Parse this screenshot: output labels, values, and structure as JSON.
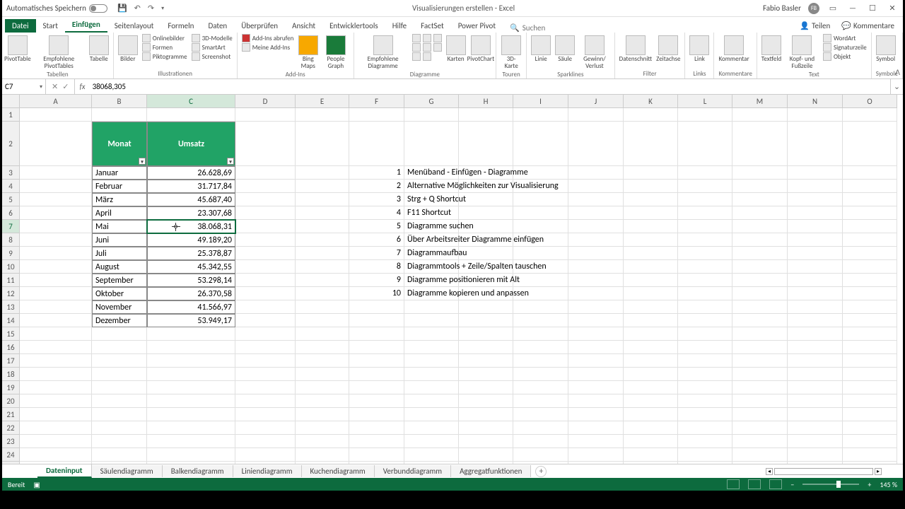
{
  "titlebar": {
    "autosave": "Automatisches Speichern",
    "doc_title": "Visualisierungen erstellen - Excel",
    "user": "Fabio Basler",
    "user_initials": "FB"
  },
  "tabs": {
    "file": "Datei",
    "items": [
      "Start",
      "Einfügen",
      "Seitenlayout",
      "Formeln",
      "Daten",
      "Überprüfen",
      "Ansicht",
      "Entwicklertools",
      "Hilfe",
      "FactSet",
      "Power Pivot"
    ],
    "active": "Einfügen",
    "search_placeholder": "Suchen",
    "share": "Teilen",
    "comments": "Kommentare"
  },
  "ribbon": {
    "groups": {
      "tabellen": {
        "label": "Tabellen",
        "pivottable": "PivotTable",
        "empfohlene": "Empfohlene\nPivotTables",
        "tabelle": "Tabelle"
      },
      "illustrationen": {
        "label": "Illustrationen",
        "bilder": "Bilder",
        "onlinebilder": "Onlinebilder",
        "formen": "Formen",
        "piktogramme": "Piktogramme",
        "modelle": "3D-Modelle",
        "smartart": "SmartArt",
        "screenshot": "Screenshot"
      },
      "addins": {
        "label": "Add-Ins",
        "abrufen": "Add-Ins abrufen",
        "meine": "Meine Add-Ins",
        "bing": "Bing\nMaps",
        "people": "People\nGraph"
      },
      "diagramme": {
        "label": "Diagramme",
        "empfohlene": "Empfohlene\nDiagramme",
        "karten": "Karten",
        "pivotchart": "PivotChart"
      },
      "touren": {
        "label": "Touren",
        "karte": "3D-\nKarte"
      },
      "sparklines": {
        "label": "Sparklines",
        "linie": "Linie",
        "saule": "Säule",
        "gewinn": "Gewinn/\nVerlust"
      },
      "filter": {
        "label": "Filter",
        "datenschnitt": "Datenschnitt",
        "zeitachse": "Zeitachse"
      },
      "links": {
        "label": "Links",
        "link": "Link"
      },
      "kommentare": {
        "label": "Kommentare",
        "kommentar": "Kommentar"
      },
      "text": {
        "label": "Text",
        "textfeld": "Textfeld",
        "kopf": "Kopf- und\nFußzeile",
        "wordart": "WordArt",
        "signatur": "Signaturzeile",
        "objekt": "Objekt"
      },
      "symbole": {
        "label": "Symbole",
        "symbol": "Symbol"
      }
    }
  },
  "formulabar": {
    "namebox": "C7",
    "formula": "38068,305"
  },
  "columns": [
    "A",
    "B",
    "C",
    "D",
    "E",
    "F",
    "G",
    "H",
    "I",
    "J",
    "K",
    "L",
    "M",
    "N",
    "O"
  ],
  "table": {
    "headers": {
      "monat": "Monat",
      "umsatz": "Umsatz"
    },
    "rows": [
      {
        "m": "Januar",
        "u": "26.628,69"
      },
      {
        "m": "Februar",
        "u": "31.717,84"
      },
      {
        "m": "März",
        "u": "45.687,40"
      },
      {
        "m": "April",
        "u": "23.307,68"
      },
      {
        "m": "Mai",
        "u": "38.068,31"
      },
      {
        "m": "Juni",
        "u": "49.189,20"
      },
      {
        "m": "Juli",
        "u": "25.378,87"
      },
      {
        "m": "August",
        "u": "45.342,55"
      },
      {
        "m": "September",
        "u": "53.298,14"
      },
      {
        "m": "Oktober",
        "u": "26.370,58"
      },
      {
        "m": "November",
        "u": "41.566,97"
      },
      {
        "m": "Dezember",
        "u": "53.949,17"
      }
    ]
  },
  "notes": [
    {
      "n": "1",
      "t": "Menüband - Einfügen - Diagramme"
    },
    {
      "n": "2",
      "t": "Alternative Möglichkeiten zur Visualisierung"
    },
    {
      "n": "3",
      "t": "Strg + Q Shortcut"
    },
    {
      "n": "4",
      "t": "F11 Shortcut"
    },
    {
      "n": "5",
      "t": "Diagramme suchen"
    },
    {
      "n": "6",
      "t": "Über Arbeitsreiter Diagramme einfügen"
    },
    {
      "n": "7",
      "t": "Diagrammaufbau"
    },
    {
      "n": "8",
      "t": "Diagrammtools + Zeile/Spalten tauschen"
    },
    {
      "n": "9",
      "t": "Diagramme positionieren mit Alt"
    },
    {
      "n": "10",
      "t": "Diagramme kopieren und anpassen"
    }
  ],
  "sheets": {
    "active": "Dateninput",
    "list": [
      "Dateninput",
      "Säulendiagramm",
      "Balkendiagramm",
      "Liniendiagramm",
      "Kuchendiagramm",
      "Verbunddiagramm",
      "Aggregatfunktionen"
    ]
  },
  "status": {
    "ready": "Bereit",
    "zoom": "145 %"
  },
  "selected_cell": "C7",
  "selected_row": 7,
  "selected_col": "C"
}
